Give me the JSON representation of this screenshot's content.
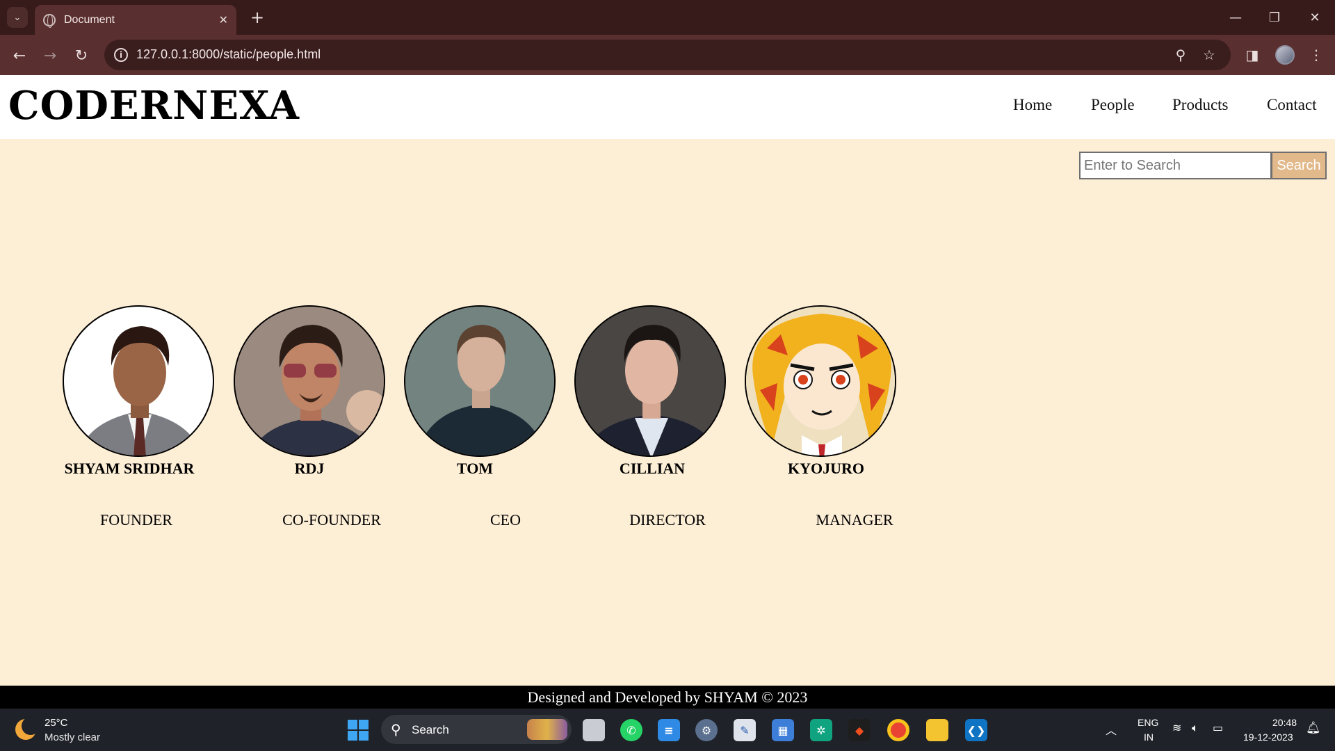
{
  "browser": {
    "tab_title": "Document",
    "url": "127.0.0.1:8000/static/people.html"
  },
  "site": {
    "logo": "CODERNEXA",
    "nav": [
      "Home",
      "People",
      "Products",
      "Contact"
    ],
    "search": {
      "placeholder": "Enter to Search",
      "button": "Search"
    }
  },
  "people": [
    {
      "name": "SHYAM SRIDHAR",
      "role": "FOUNDER"
    },
    {
      "name": "RDJ",
      "role": "CO-FOUNDER"
    },
    {
      "name": "TOM",
      "role": "CEO"
    },
    {
      "name": "CILLIAN",
      "role": "DIRECTOR"
    },
    {
      "name": "KYOJURO",
      "role": "MANAGER"
    }
  ],
  "footer": {
    "text": "Designed and Developed by SHYAM © 2023"
  },
  "taskbar": {
    "weather_temp": "25°C",
    "weather_cond": "Mostly clear",
    "search_label": "Search",
    "lang_line1": "ENG",
    "lang_line2": "IN",
    "time": "20:48",
    "date": "19-12-2023"
  },
  "colors": {
    "page_bg": "#fdeed6",
    "browser_frame": "#371a1a",
    "search_button": "#e2b98b",
    "footer_bg": "#000000"
  }
}
